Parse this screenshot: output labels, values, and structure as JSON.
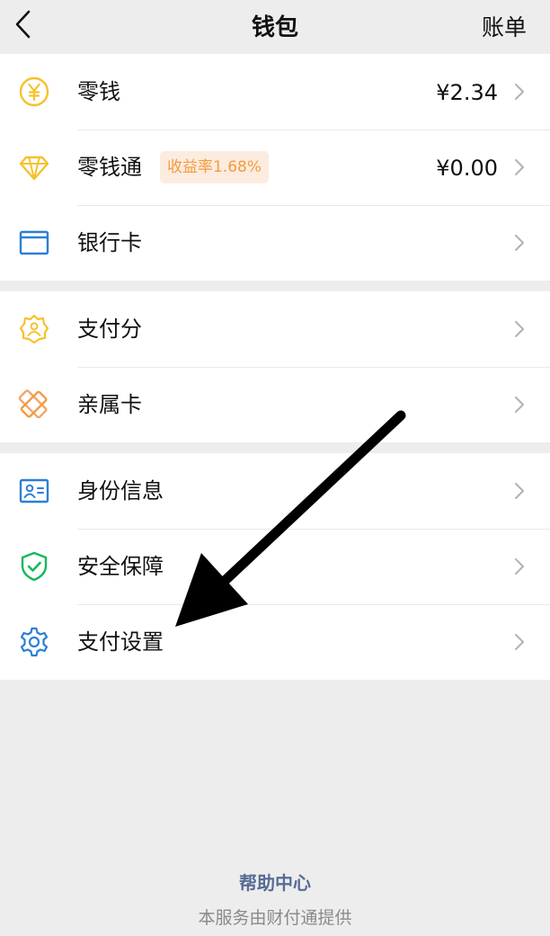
{
  "nav": {
    "title": "钱包",
    "right_label": "账单"
  },
  "groups": [
    {
      "items": [
        {
          "label": "零钱",
          "value": "¥2.34",
          "icon": "yuan-coin-icon"
        },
        {
          "label": "零钱通",
          "badge": "收益率1.68%",
          "value": "¥0.00",
          "icon": "diamond-icon"
        },
        {
          "label": "银行卡",
          "icon": "bank-card-icon"
        }
      ]
    },
    {
      "items": [
        {
          "label": "支付分",
          "icon": "payment-score-icon"
        },
        {
          "label": "亲属卡",
          "icon": "family-card-icon"
        }
      ]
    },
    {
      "items": [
        {
          "label": "身份信息",
          "icon": "id-card-icon"
        },
        {
          "label": "安全保障",
          "icon": "shield-check-icon"
        },
        {
          "label": "支付设置",
          "icon": "gear-icon"
        }
      ]
    }
  ],
  "footer": {
    "help_label": "帮助中心",
    "note": "本服务由财付通提供"
  },
  "colors": {
    "accent_yellow": "#f6c12d",
    "accent_blue": "#2b7fd6",
    "accent_green": "#16b85b",
    "accent_orange": "#f59a3f",
    "link": "#576b95"
  }
}
